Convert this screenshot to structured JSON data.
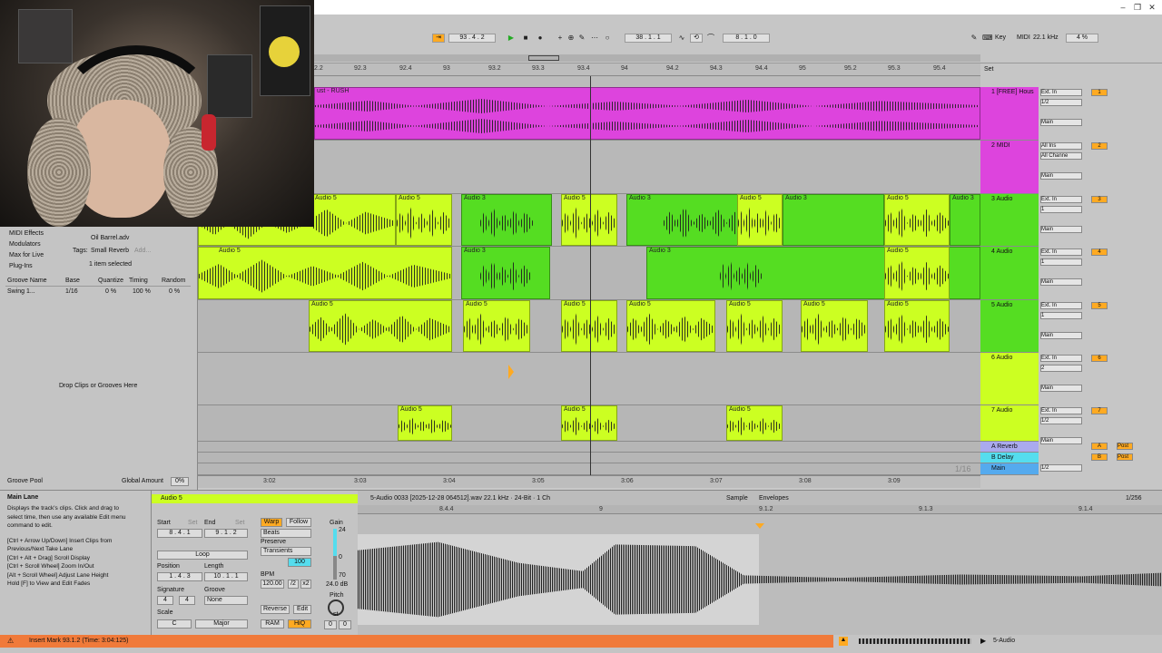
{
  "transport": {
    "song_position": "93 .  4 .  2",
    "loop_start": "38 .  1 .  1",
    "loop_length": "8 .  1 .  0",
    "key_label": "Key",
    "midi_label": "MIDI",
    "sample_rate": "22.1 kHz",
    "cpu": "4 %"
  },
  "ruler": {
    "ticks": [
      "2.2",
      "92.3",
      "92.4",
      "93",
      "93.2",
      "93.3",
      "93.4",
      "94",
      "94.2",
      "94.3",
      "94.4",
      "95",
      "95.2",
      "95.3",
      "95.4"
    ],
    "time_ticks": [
      "3:02",
      "3:03",
      "3:04",
      "3:05",
      "3:06",
      "3:07",
      "3:08",
      "3:09"
    ],
    "zoom": "1/16",
    "set_label": "Set"
  },
  "tracks": [
    {
      "name": "1 [FREE] Hous",
      "input": "Ext. In",
      "channel": "1/2",
      "output": "Main",
      "num": "1"
    },
    {
      "name": "2 MIDI",
      "input": "All Ins",
      "channel": "All Channe",
      "output": "Main",
      "num": "2"
    },
    {
      "name": "3 Audio",
      "input": "Ext. In",
      "channel": "1",
      "output": "Main",
      "num": "3"
    },
    {
      "name": "4 Audio",
      "input": "Ext. In",
      "channel": "1",
      "output": "Main",
      "num": "4"
    },
    {
      "name": "5 Audio",
      "input": "Ext. In",
      "channel": "1",
      "output": "Main",
      "num": "5"
    },
    {
      "name": "6 Audio",
      "input": "Ext. In",
      "channel": "2",
      "output": "Main",
      "num": "6"
    },
    {
      "name": "7 Audio",
      "input": "Ext. In",
      "channel": "1/2",
      "output": "Main",
      "num": "7"
    }
  ],
  "returns": [
    {
      "name": "A Reverb",
      "letter": "A"
    },
    {
      "name": "B Delay",
      "letter": "B"
    },
    {
      "name": "Main",
      "letter": ""
    }
  ],
  "mixer_labels": {
    "in": "In",
    "auto": "Auto",
    "off": "Off",
    "s": "S",
    "c": "C",
    "neg_inf": "-∞",
    "zero": "0",
    "post": "Post",
    "main_ch": "1/2"
  },
  "clip_names": {
    "track1": "ust - RUSH",
    "audio5": "Audio 5",
    "audio3": "Audio 3"
  },
  "browser": {
    "categories": [
      "MIDI Effects",
      "Modulators",
      "Max for Live",
      "Plug-Ins"
    ],
    "file": "Oil Barrel.adv",
    "tags_label": "Tags:",
    "tag": "Small Reverb",
    "add": "Add...",
    "selected": "1 item selected",
    "groove_headers": [
      "Groove Name",
      "Base",
      "Quantize",
      "Timing",
      "Random"
    ],
    "groove_row": [
      "Swing 1...",
      "1/16",
      "0 %",
      "100 %",
      "0 %"
    ],
    "drop_hint": "Drop Clips or Grooves Here",
    "groove_pool": "Groove Pool",
    "global_amount_label": "Global Amount",
    "global_amount": "0%"
  },
  "info": {
    "title": "Main Lane",
    "lines": [
      "Displays the track's clips. Click and drag to",
      "select time, then use any available Edit menu",
      "command to edit.",
      "",
      "[Ctrl + Arrow Up/Down] Insert Clips from",
      "Previous/Next Take Lane",
      "[Ctrl + Alt + Drag] Scroll Display",
      "[Ctrl + Scroll Wheel] Zoom In/Out",
      "[Alt + Scroll Wheel] Adjust Lane Height",
      "Hold [F] to View and Edit Fades"
    ]
  },
  "clip": {
    "name": "Audio 5",
    "start_label": "Start",
    "end_label": "End",
    "set": "Set",
    "start": "8 .  4 .  1",
    "end": "9 .  1 .  2",
    "loop": "Loop",
    "position_label": "Position",
    "length_label": "Length",
    "position": "1 .  4 .  3",
    "length": "10 .  1 .  1",
    "signature_label": "Signature",
    "groove_label": "Groove",
    "sig_num": "4",
    "sig_den": "4",
    "groove": "None",
    "scale_label": "Scale",
    "scale_root": "C",
    "scale_mode": "Major",
    "warp": "Warp",
    "follow": "Follow",
    "beats": "Beats",
    "preserve_label": "Preserve",
    "preserve": "Transients",
    "transient_val": "100",
    "bpm_label": "BPM",
    "bpm": "120.00",
    "half": "/2",
    "double": "x2",
    "reverse": "Reverse",
    "edit": "Edit",
    "ram": "RAM",
    "hiq": "HiQ",
    "gain_label": "Gain",
    "gain": "24.0 dB",
    "gain_max": "24",
    "gain_zero": "0",
    "gain_min": "70",
    "pitch_label": "Pitch",
    "pitch_unit": "st",
    "pitch_st": "0",
    "pitch_ct": "0"
  },
  "sample": {
    "file_info": "5-Audio 0033 [2025-12-28 064512].wav  22.1 kHz · 24-Bit · 1 Ch",
    "tab_sample": "Sample",
    "tab_envelopes": "Envelopes",
    "zoom": "1/256",
    "ruler": [
      "8.4.4",
      "9",
      "9.1.2",
      "9.1.3",
      "9.1.4"
    ]
  },
  "status": {
    "message": "Insert Mark 93.1.2 (Time: 3:04:125)",
    "track": "5-Audio"
  },
  "colors": {
    "magenta": "#dd44dd",
    "lime": "#ccff22",
    "green": "#55dd22",
    "orange": "#ffaa22",
    "status_orange": "#f07a3a"
  }
}
